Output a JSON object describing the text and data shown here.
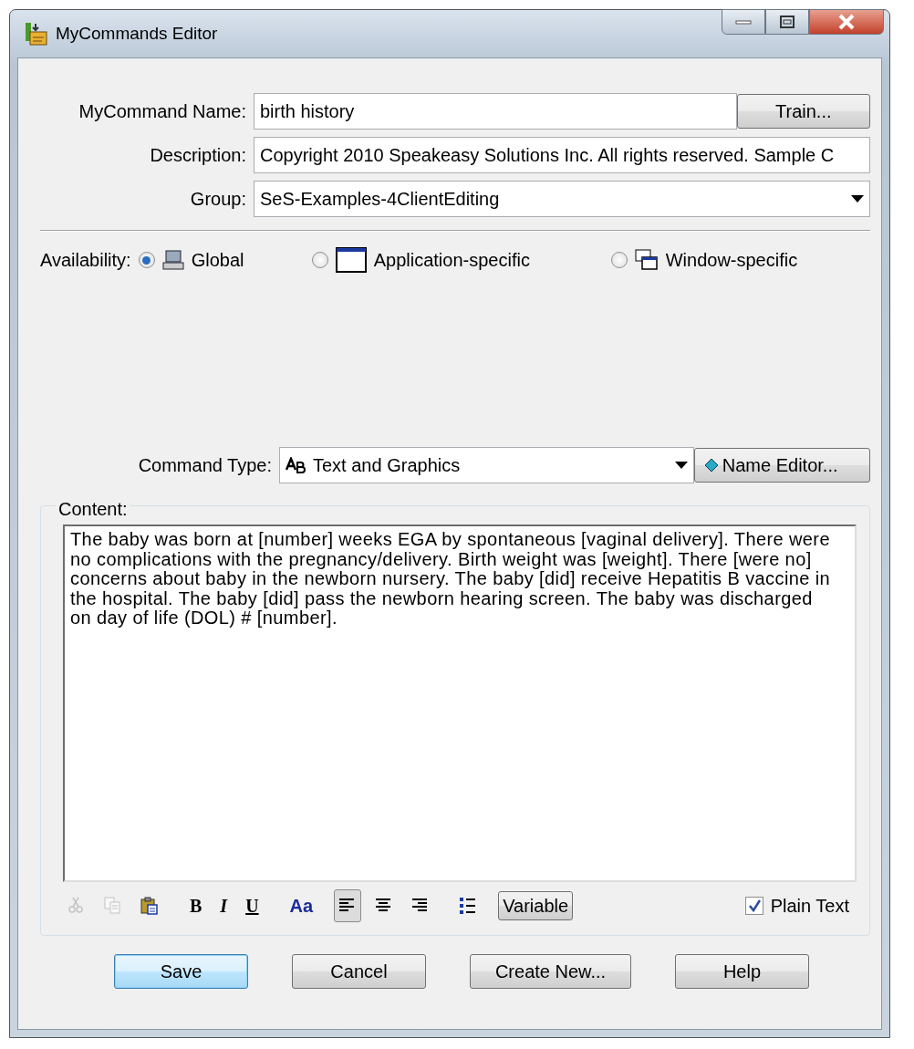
{
  "window": {
    "title": "MyCommands Editor"
  },
  "name_field": {
    "label": "MyCommand Name:",
    "value": "birth history"
  },
  "train_button": {
    "label": "Train..."
  },
  "description_field": {
    "label": "Description:",
    "value": "Copyright 2010 Speakeasy Solutions Inc.  All rights reserved.  Sample C"
  },
  "group": {
    "label": "Group:",
    "value": "SeS-Examples-4ClientEditing"
  },
  "availability": {
    "label": "Availability:",
    "options": [
      {
        "label": "Global",
        "kind": "global",
        "selected": true
      },
      {
        "label": "Application-specific",
        "kind": "application",
        "selected": false
      },
      {
        "label": "Window-specific",
        "kind": "window",
        "selected": false
      }
    ]
  },
  "command_type": {
    "label": "Command Type:",
    "value": "Text and Graphics"
  },
  "name_editor_button": {
    "label": "Name Editor..."
  },
  "content": {
    "label": "Content:",
    "text": "The baby was born at [number] weeks EGA by spontaneous [vaginal delivery]. There were no complications with the pregnancy/delivery. Birth weight was [weight]. There [were no] concerns about baby in the newborn nursery. The baby [did] receive Hepatitis B vaccine in the hospital. The baby [did] pass the newborn hearing screen.  The baby was discharged on day of life (DOL) # [number]."
  },
  "toolbar": [
    {
      "kind": "cut",
      "disabled": true
    },
    {
      "kind": "copy",
      "disabled": true
    },
    {
      "kind": "paste",
      "disabled": false
    },
    {
      "kind": "bold",
      "text": "B"
    },
    {
      "kind": "italic",
      "text": "I"
    },
    {
      "kind": "underline",
      "text": "U"
    },
    {
      "kind": "font",
      "text": "Aa"
    },
    {
      "kind": "align-left",
      "selected": true
    },
    {
      "kind": "align-center",
      "selected": false
    },
    {
      "kind": "align-right",
      "selected": false
    },
    {
      "kind": "bullets"
    }
  ],
  "variable_button": {
    "label": "Variable"
  },
  "plain_text": {
    "label": "Plain Text",
    "checked": true
  },
  "buttons": [
    {
      "label": "Save",
      "default": true
    },
    {
      "label": "Cancel",
      "default": false
    },
    {
      "label": "Create New...",
      "default": false
    },
    {
      "label": "Help",
      "default": false
    }
  ]
}
